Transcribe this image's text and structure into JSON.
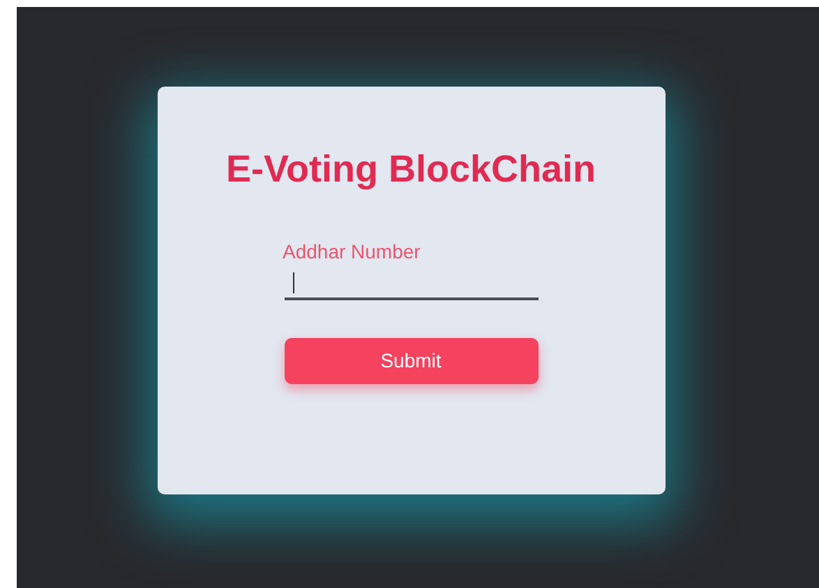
{
  "card": {
    "title": "E-Voting BlockChain",
    "field": {
      "label": "Addhar Number",
      "focused": true
    },
    "submit": "Submit"
  }
}
